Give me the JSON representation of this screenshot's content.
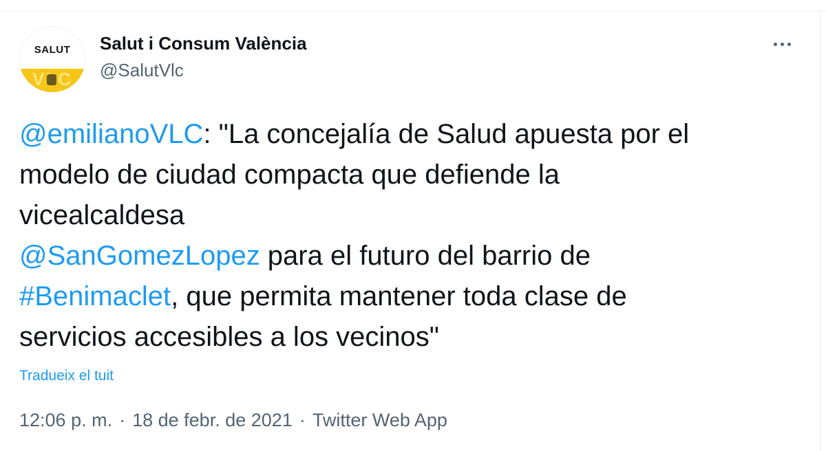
{
  "tweet": {
    "author": {
      "name": "Salut i Consum València",
      "handle": "@SalutVlc",
      "avatar_text": "SALUT",
      "avatar_subtext": "VLC",
      "avatar_icon": "salut-logo-icon"
    },
    "more_icon": "more-horizontal-icon",
    "body": {
      "line1_mention": "@emilianoVLC",
      "line1_text": ": \"La concejalía de Salud apuesta por el",
      "line2_text": "modelo de ciudad compacta que defiende la",
      "line3_text": "vicealcaldesa",
      "line4_mention": "@SanGomezLopez",
      "line4_text": " para el futuro del barrio de",
      "line5_hashtag": "#Benimaclet",
      "line5_text": ", que permita mantener toda clase de",
      "line6_text": "servicios accesibles a los vecinos\""
    },
    "translate_label": "Tradueix el tuit",
    "time": "12:06 p. m.",
    "separator": "·",
    "date": "18 de febr. de 2021",
    "source": "Twitter Web App"
  },
  "colors": {
    "link": "#1d9bf0",
    "text": "#0f1419",
    "secondary": "#536471",
    "avatar_yellow": "#f5c518"
  }
}
